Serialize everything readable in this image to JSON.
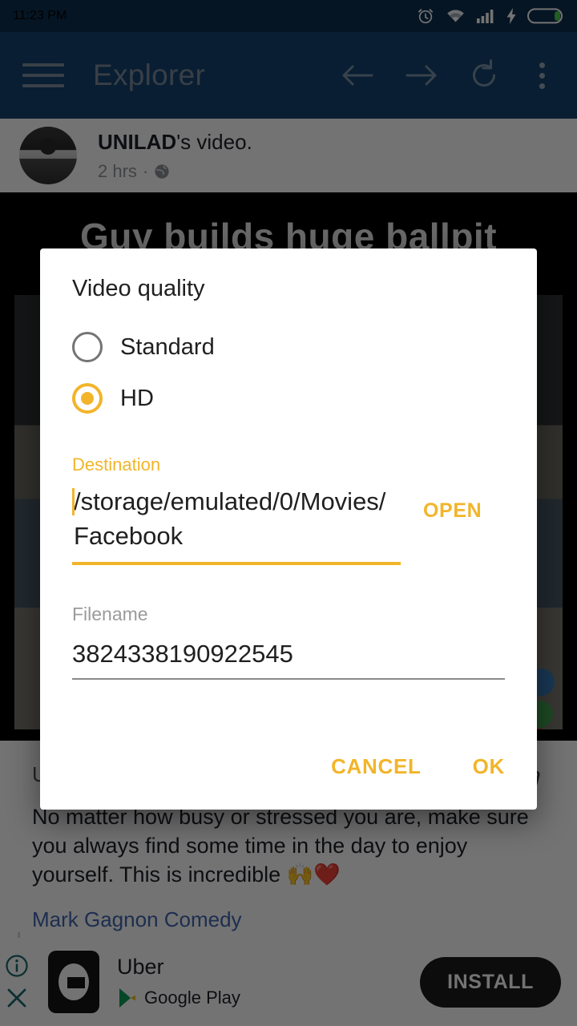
{
  "status_bar": {
    "time": "11:23 PM",
    "icons": [
      "alarm-icon",
      "wifi-icon",
      "signal-icon",
      "charging-bolt-icon",
      "battery-icon"
    ]
  },
  "toolbar": {
    "menu_icon": "hamburger-menu-icon",
    "title": "Explorer",
    "back_icon": "arrow-left-icon",
    "forward_icon": "arrow-right-icon",
    "reload_icon": "refresh-icon",
    "overflow_icon": "more-vertical-icon"
  },
  "background_post": {
    "author": "UNILAD",
    "title_suffix": "'s video.",
    "timestamp": "2 hrs",
    "separator": "·",
    "privacy_icon": "globe-icon",
    "video_overlay_title": "Guy builds huge ballpit",
    "like_icon": "thumbs-up-icon",
    "body": "No matter how busy or stressed you are, make sure you always find some time in the day to enjoy yourself. This is incredible 🙌❤️",
    "link": "Mark Gagnon Comedy"
  },
  "ad": {
    "info_icon": "info-circle-icon",
    "close_icon": "close-x-icon",
    "app_icon": "uber-app-icon",
    "app_name": "Uber",
    "store_brand": "Google",
    "store_brand_suffix": " Play",
    "store_icon": "google-play-icon",
    "install_label": "INSTALL"
  },
  "dialog": {
    "title": "Video quality",
    "options": [
      {
        "label": "Standard",
        "selected": false
      },
      {
        "label": "HD",
        "selected": true
      }
    ],
    "destination": {
      "label": "Destination",
      "value": "/storage/emulated/0/Movies/Facebook",
      "open_label": "OPEN"
    },
    "filename": {
      "label": "Filename",
      "value": "3824338190922545"
    },
    "cancel_label": "CANCEL",
    "ok_label": "OK"
  },
  "colors": {
    "accent": "#F2B52A",
    "toolbar": "#164370",
    "status_bar": "#0F2F50",
    "link": "#4267B2",
    "install_bg": "#1C1C1C"
  }
}
